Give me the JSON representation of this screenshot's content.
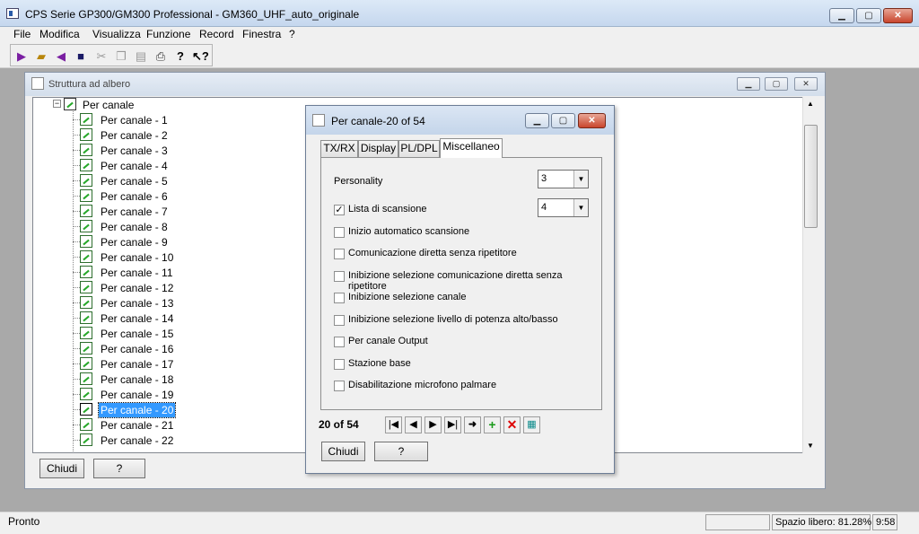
{
  "window": {
    "title": "CPS Serie GP300/GM300 Professional - GM360_UHF_auto_originale",
    "min": "▁",
    "max": "▢",
    "close": "✕"
  },
  "menu": [
    "File",
    "Modifica",
    "Visualizza",
    "Funzione",
    "Record",
    "Finestra",
    "?"
  ],
  "toolbar": {
    "icons": [
      "read-radio-icon",
      "open-icon",
      "write-radio-icon",
      "save-icon",
      "cut-icon",
      "copy-icon",
      "paste-icon",
      "print-icon",
      "help-icon",
      "context-help-icon"
    ]
  },
  "tree_window": {
    "title": "Struttura ad albero",
    "root": "Per canale",
    "items": [
      "Per canale - 1",
      "Per canale - 2",
      "Per canale - 3",
      "Per canale - 4",
      "Per canale - 5",
      "Per canale - 6",
      "Per canale - 7",
      "Per canale - 8",
      "Per canale - 9",
      "Per canale - 10",
      "Per canale - 11",
      "Per canale - 12",
      "Per canale - 13",
      "Per canale - 14",
      "Per canale - 15",
      "Per canale - 16",
      "Per canale - 17",
      "Per canale - 18",
      "Per canale - 19",
      "Per canale - 20",
      "Per canale - 21",
      "Per canale - 22"
    ],
    "selected": "Per canale - 20",
    "close_label": "Chiudi",
    "help_label": "?"
  },
  "dialog": {
    "title": "Per canale-20 of 54",
    "tabs": [
      "TX/RX",
      "Display",
      "PL/DPL",
      "Miscellaneo"
    ],
    "active_tab": "Miscellaneo",
    "personality_label": "Personality",
    "personality_value": "3",
    "scan_list_value": "4",
    "options": [
      {
        "label": "Lista di scansione",
        "checked": true
      },
      {
        "label": "Inizio automatico scansione",
        "checked": false
      },
      {
        "label": "Comunicazione diretta senza ripetitore",
        "checked": false
      },
      {
        "label": "Inibizione selezione comunicazione diretta senza ripetitore",
        "checked": false
      },
      {
        "label": "Inibizione selezione canale",
        "checked": false
      },
      {
        "label": "Inibizione selezione livello di potenza alto/basso",
        "checked": false
      },
      {
        "label": "Per canale Output",
        "checked": false
      },
      {
        "label": "Stazione base",
        "checked": false
      },
      {
        "label": "Disabilitazione microfono palmare",
        "checked": false
      }
    ],
    "record_counter": "20 of 54",
    "nav_icons": [
      "first-record-icon",
      "prev-record-icon",
      "next-record-icon",
      "last-record-icon",
      "goto-icon",
      "add-record-icon",
      "delete-record-icon",
      "grid-view-icon"
    ],
    "close_label": "Chiudi",
    "help_label": "?"
  },
  "status": {
    "text": "Pronto",
    "free_space": "Spazio libero: 81.28%",
    "time": "9:58"
  }
}
